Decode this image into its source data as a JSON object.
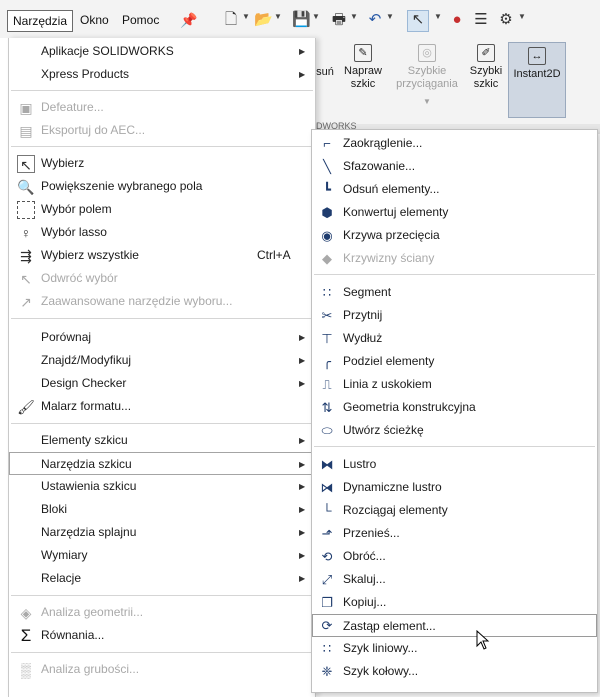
{
  "menubar": {
    "items": [
      "Narzędzia",
      "Okno",
      "Pomoc"
    ],
    "active": "Narzędzia",
    "pin_icon": "pin-icon",
    "toolbar_icons": [
      "new-document-icon",
      "open-icon",
      "save-icon",
      "print-icon",
      "undo-icon",
      "select-pointer-icon",
      "traffic-light-icon",
      "file-properties-icon",
      "options-gear-icon"
    ]
  },
  "ribbon": {
    "buttons": [
      {
        "label": "suń",
        "state": "normal"
      },
      {
        "label": "Napraw szkic",
        "state": "normal"
      },
      {
        "label": "Szybkie przyciągania",
        "state": "disabled"
      },
      {
        "label": "Szybki szkic",
        "state": "normal"
      },
      {
        "label": "Instant2D",
        "state": "pressed"
      }
    ],
    "tab_fragment": "DWORKS"
  },
  "menu": {
    "groups": [
      [
        {
          "label": "Aplikacje SOLIDWORKS",
          "submenu": true
        },
        {
          "label": "Xpress Products",
          "submenu": true
        }
      ],
      [
        {
          "label": "Defeature...",
          "icon": "defeature-icon",
          "disabled": true
        },
        {
          "label": "Eksportuj do AEC...",
          "icon": "export-aec-icon",
          "disabled": true
        }
      ],
      [
        {
          "label": "Wybierz",
          "icon": "select-arrow-icon"
        },
        {
          "label": "Powiększenie wybranego pola",
          "icon": "zoom-selection-icon"
        },
        {
          "label": "Wybór polem",
          "icon": "box-select-icon"
        },
        {
          "label": "Wybór lasso",
          "icon": "lasso-icon"
        },
        {
          "label": "Wybierz wszystkie",
          "icon": "select-all-icon",
          "shortcut": "Ctrl+A"
        },
        {
          "label": "Odwróć wybór",
          "icon": "invert-selection-icon",
          "disabled": true
        },
        {
          "label": "Zaawansowane narzędzie wyboru...",
          "icon": "advanced-select-icon",
          "disabled": true
        }
      ],
      [
        {
          "label": "Porównaj",
          "submenu": true
        },
        {
          "label": "Znajdź/Modyfikuj",
          "submenu": true
        },
        {
          "label": "Design Checker",
          "submenu": true
        },
        {
          "label": "Malarz formatu...",
          "icon": "format-painter-icon"
        }
      ],
      [
        {
          "label": "Elementy szkicu",
          "submenu": true
        },
        {
          "label": "Narzędzia szkicu",
          "submenu": true,
          "highlighted": true
        },
        {
          "label": "Ustawienia szkicu",
          "submenu": true
        },
        {
          "label": "Bloki",
          "submenu": true
        },
        {
          "label": "Narzędzia splajnu",
          "submenu": true
        },
        {
          "label": "Wymiary",
          "submenu": true
        },
        {
          "label": "Relacje",
          "submenu": true
        }
      ],
      [
        {
          "label": "Analiza geometrii...",
          "icon": "geometry-analysis-icon",
          "disabled": true
        },
        {
          "label": "Równania...",
          "icon": "sigma-icon"
        }
      ],
      [
        {
          "label": "Analiza grubości...",
          "icon": "thickness-analysis-icon",
          "disabled": true
        }
      ]
    ]
  },
  "submenu": {
    "groups": [
      [
        {
          "label": "Zaokrąglenie...",
          "icon": "fillet-icon"
        },
        {
          "label": "Sfazowanie...",
          "icon": "chamfer-icon"
        },
        {
          "label": "Odsuń elementy...",
          "icon": "offset-icon"
        },
        {
          "label": "Konwertuj elementy",
          "icon": "convert-entities-icon"
        },
        {
          "label": "Krzywa przecięcia",
          "icon": "intersection-curve-icon"
        },
        {
          "label": "Krzywizny ściany",
          "icon": "face-curves-icon",
          "disabled": true
        }
      ],
      [
        {
          "label": "Segment",
          "icon": "segment-icon"
        },
        {
          "label": "Przytnij",
          "icon": "trim-icon"
        },
        {
          "label": "Wydłuż",
          "icon": "extend-icon"
        },
        {
          "label": "Podziel elementy",
          "icon": "split-entities-icon"
        },
        {
          "label": "Linia z uskokiem",
          "icon": "jog-line-icon"
        },
        {
          "label": "Geometria konstrukcyjna",
          "icon": "construction-geometry-icon"
        },
        {
          "label": "Utwórz ścieżkę",
          "icon": "make-path-icon"
        }
      ],
      [
        {
          "label": "Lustro",
          "icon": "mirror-icon"
        },
        {
          "label": "Dynamiczne lustro",
          "icon": "dynamic-mirror-icon"
        },
        {
          "label": "Rozciągaj elementy",
          "icon": "stretch-icon"
        },
        {
          "label": "Przenieś...",
          "icon": "move-icon"
        },
        {
          "label": "Obróć...",
          "icon": "rotate-icon"
        },
        {
          "label": "Skaluj...",
          "icon": "scale-icon"
        },
        {
          "label": "Kopiuj...",
          "icon": "copy-icon"
        },
        {
          "label": "Zastąp element...",
          "icon": "replace-entity-icon",
          "highlighted": true
        },
        {
          "label": "Szyk liniowy...",
          "icon": "linear-pattern-icon"
        },
        {
          "label": "Szyk kołowy...",
          "icon": "circular-pattern-icon"
        }
      ]
    ]
  }
}
